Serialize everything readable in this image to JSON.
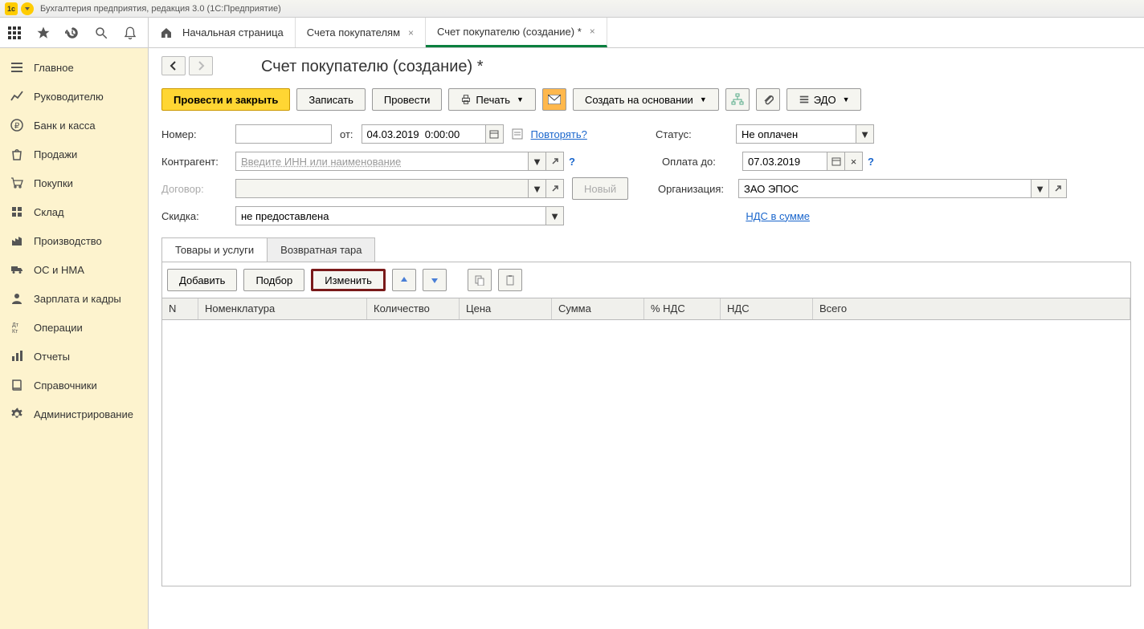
{
  "window_title": "Бухгалтерия предприятия, редакция 3.0   (1С:Предприятие)",
  "tabs": {
    "home": "Начальная страница",
    "tab1": "Счета покупателям",
    "tab2": "Счет покупателю (создание) *"
  },
  "sidebar": {
    "items": [
      "Главное",
      "Руководителю",
      "Банк и касса",
      "Продажи",
      "Покупки",
      "Склад",
      "Производство",
      "ОС и НМА",
      "Зарплата и кадры",
      "Операции",
      "Отчеты",
      "Справочники",
      "Администрирование"
    ]
  },
  "page": {
    "title": "Счет покупателю (создание) *"
  },
  "actions": {
    "post_close": "Провести и закрыть",
    "write": "Записать",
    "post": "Провести",
    "print": "Печать",
    "create_based_on": "Создать на основании",
    "edo": "ЭДО"
  },
  "form": {
    "number_label": "Номер:",
    "from_label": "от:",
    "date_value": "04.03.2019  0:00:00",
    "repeat_link": "Повторять?",
    "status_label": "Статус:",
    "status_value": "Не оплачен",
    "counterparty_label": "Контрагент:",
    "counterparty_placeholder": "Введите ИНН или наименование",
    "contract_label": "Договор:",
    "new_btn": "Новый",
    "discount_label": "Скидка:",
    "discount_value": "не предоставлена",
    "paydue_label": "Оплата до:",
    "paydue_value": "07.03.2019",
    "org_label": "Организация:",
    "org_value": "ЗАО ЭПОС",
    "vat_link": "НДС в сумме"
  },
  "subtabs": {
    "goods": "Товары и услуги",
    "tare": "Возвратная тара"
  },
  "table_toolbar": {
    "add": "Добавить",
    "pick": "Подбор",
    "change": "Изменить"
  },
  "table": {
    "columns": {
      "n": "N",
      "nomen": "Номенклатура",
      "qty": "Количество",
      "price": "Цена",
      "sum": "Сумма",
      "vatpct": "% НДС",
      "vat": "НДС",
      "total": "Всего"
    }
  }
}
